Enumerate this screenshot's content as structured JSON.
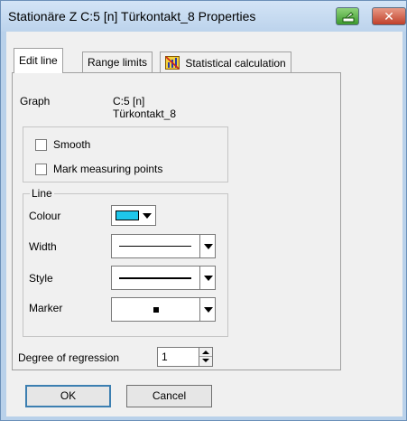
{
  "window": {
    "title": "Stationäre Z C:5 [n] Türkontakt_8 Properties",
    "config_icon": "config-icon",
    "close_glyph": "✕"
  },
  "tabs": [
    {
      "label": "Edit line",
      "active": true
    },
    {
      "label": "Range limits",
      "active": false
    },
    {
      "label": "Statistical calculation",
      "active": false,
      "icon": "statistics-icon"
    }
  ],
  "graph": {
    "label": "Graph",
    "value_line1": "C:5 [n]",
    "value_line2": "Türkontakt_8"
  },
  "options": {
    "smooth_label": "Smooth",
    "smooth_checked": false,
    "mark_points_label": "Mark measuring points",
    "mark_points_checked": false
  },
  "line_group": {
    "title": "Line",
    "colour_label": "Colour",
    "colour_value": "#1ec6ea",
    "width_label": "Width",
    "style_label": "Style",
    "marker_label": "Marker"
  },
  "regression": {
    "label": "Degree of regression",
    "value": "1"
  },
  "buttons": {
    "ok": "OK",
    "cancel": "Cancel"
  }
}
